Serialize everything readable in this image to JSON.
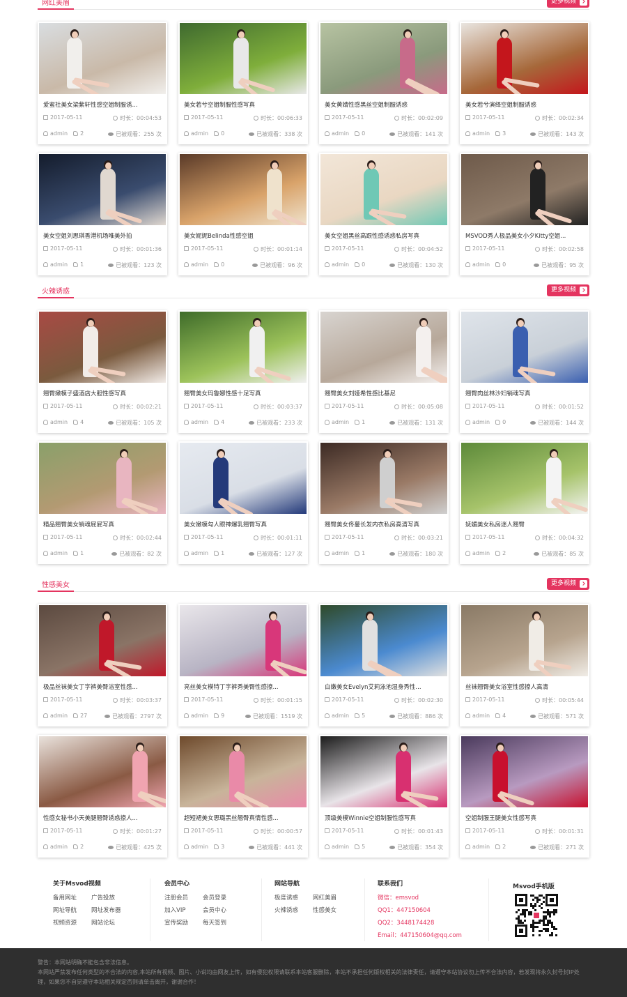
{
  "colors": {
    "accent": "#e4345f",
    "footer_bg": "#2f2f2f"
  },
  "sections": [
    {
      "title": "网红美眉",
      "more": "更多视频",
      "items": [
        {
          "title": "爱蜜社美女梁紫轩性感空姐制服诱...",
          "date": "2017-05-11",
          "duration": "时长：00:04:53",
          "author": "admin",
          "likes": "2",
          "views": "已被观看：255 次",
          "palette": [
            "#d9dde0",
            "#c9b9a8",
            "#f1efec"
          ]
        },
        {
          "title": "美女若兮空姐制服性感写真",
          "date": "2017-05-11",
          "duration": "时长：00:06:33",
          "author": "admin",
          "likes": "0",
          "views": "已被观看：338 次",
          "palette": [
            "#3f6a2f",
            "#7fae3b",
            "#e8e8e8"
          ]
        },
        {
          "title": "美女黄婧性感黑丝空姐制服诱惑",
          "date": "2017-05-11",
          "duration": "时长：00:02:09",
          "author": "admin",
          "likes": "0",
          "views": "已被观看：141 次",
          "palette": [
            "#b7c3a2",
            "#8a9a7c",
            "#c76b8a"
          ]
        },
        {
          "title": "美女若兮演绎空姐制服诱惑",
          "date": "2017-05-11",
          "duration": "时长：00:02:34",
          "author": "admin",
          "likes": "3",
          "views": "已被观看：143 次",
          "palette": [
            "#e9e5e0",
            "#a6683a",
            "#c4161c"
          ]
        },
        {
          "title": "美女空姐刘思琪香港机场唯美外拍",
          "date": "2017-05-11",
          "duration": "时长：00:01:36",
          "author": "admin",
          "likes": "1",
          "views": "已被观看：123 次",
          "palette": [
            "#141c2c",
            "#3a4c6e",
            "#e0d8d0"
          ]
        },
        {
          "title": "美女妮妮Belinda性感空姐",
          "date": "2017-05-11",
          "duration": "时长：00:01:14",
          "author": "admin",
          "likes": "0",
          "views": "已被观看：96 次",
          "palette": [
            "#5a3a28",
            "#d9a36a",
            "#efe2cc"
          ]
        },
        {
          "title": "美女空姐黑丝高跟性感诱惑私房写真",
          "date": "2017-05-11",
          "duration": "时长：00:04:52",
          "author": "admin",
          "likes": "0",
          "views": "已被观看：130 次",
          "palette": [
            "#f2e6d8",
            "#e9d7c2",
            "#6fc8b5"
          ]
        },
        {
          "title": "MSVOD秀人极品美女小夕Kitty空姐...",
          "date": "2017-05-11",
          "duration": "时长：00:02:58",
          "author": "admin",
          "likes": "0",
          "views": "已被观看：95 次",
          "palette": [
            "#6e5a4a",
            "#8e7a68",
            "#222222"
          ]
        }
      ]
    },
    {
      "title": "火辣诱惑",
      "more": "更多视频",
      "items": [
        {
          "title": "翘臀嫩模子盛酒店大胆性感写真",
          "date": "2017-05-11",
          "duration": "时长：00:02:21",
          "author": "admin",
          "likes": "4",
          "views": "已被观看：105 次",
          "palette": [
            "#a84a44",
            "#7a5a3e",
            "#f2ece8"
          ]
        },
        {
          "title": "翘臀美女玛鲁娜性感十足写真",
          "date": "2017-05-11",
          "duration": "时长：00:03:37",
          "author": "admin",
          "likes": "4",
          "views": "已被观看：233 次",
          "palette": [
            "#3f6c2a",
            "#9cc25a",
            "#f0f0f0"
          ]
        },
        {
          "title": "翘臀美女刘娅希性感比基尼",
          "date": "2017-05-11",
          "duration": "时长：00:05:08",
          "author": "admin",
          "likes": "1",
          "views": "已被观看：131 次",
          "palette": [
            "#d8d4d0",
            "#b7a89a",
            "#f4f0ee"
          ]
        },
        {
          "title": "翘臀肉丝林沙妇销魂写真",
          "date": "2017-05-11",
          "duration": "时长：00:01:52",
          "author": "admin",
          "likes": "0",
          "views": "已被观看：144 次",
          "palette": [
            "#dfe4ea",
            "#c9d0d8",
            "#3a5fb0"
          ]
        },
        {
          "title": "精品翘臀美女销魂屁屁写真",
          "date": "2017-05-11",
          "duration": "时长：00:02:44",
          "author": "admin",
          "likes": "1",
          "views": "已被观看：82 次",
          "palette": [
            "#8aa06a",
            "#b39a72",
            "#e8b5c0"
          ]
        },
        {
          "title": "美女嫩模勾人眼神爆乳翘臀写真",
          "date": "2017-05-11",
          "duration": "时长：00:01:11",
          "author": "admin",
          "likes": "1",
          "views": "已被观看：127 次",
          "palette": [
            "#e6eaf0",
            "#d9dee6",
            "#243a7a"
          ]
        },
        {
          "title": "翘臀美女佟蔓长发内衣私房高清写真",
          "date": "2017-05-11",
          "duration": "时长：00:03:21",
          "author": "admin",
          "likes": "1",
          "views": "已被观看：180 次",
          "palette": [
            "#3c2a24",
            "#9a7a66",
            "#cfcfcf"
          ]
        },
        {
          "title": "妩媚美女私房迷人翘臀",
          "date": "2017-05-11",
          "duration": "时长：00:04:32",
          "author": "admin",
          "likes": "2",
          "views": "已被观看：85 次",
          "palette": [
            "#5d8a3a",
            "#a6c36a",
            "#f4f4f4"
          ]
        }
      ]
    },
    {
      "title": "性感美女",
      "more": "更多视频",
      "items": [
        {
          "title": "极品丝袜美女丁字裤美臀浴室性感...",
          "date": "2017-05-11",
          "duration": "时长：00:03:37",
          "author": "admin",
          "likes": "27",
          "views": "已被观看：2797 次",
          "palette": [
            "#5c4a40",
            "#8a7466",
            "#c0182a"
          ]
        },
        {
          "title": "亮丝美女模特丁字裤秀美臀性感撩...",
          "date": "2017-05-11",
          "duration": "时长：00:01:15",
          "author": "admin",
          "likes": "9",
          "views": "已被观看：1519 次",
          "palette": [
            "#e9e6ea",
            "#b8b4c4",
            "#d8377a"
          ]
        },
        {
          "title": "白嫩美女Evelyn艾莉泳池湿身秀性...",
          "date": "2017-05-11",
          "duration": "时长：00:02:30",
          "author": "admin",
          "likes": "5",
          "views": "已被观看：886 次",
          "palette": [
            "#2f4a2a",
            "#4b8ad0",
            "#e0e0e0"
          ]
        },
        {
          "title": "丝袜翘臀美女浴室性感撩人高清",
          "date": "2017-05-11",
          "duration": "时长：00:05:44",
          "author": "admin",
          "likes": "4",
          "views": "已被观看：571 次",
          "palette": [
            "#8a7a66",
            "#b7a48e",
            "#f0ece6"
          ]
        },
        {
          "title": "性感女秘书小天美腿翘臀诱惑撩人...",
          "date": "2017-05-11",
          "duration": "时长：00:01:27",
          "author": "admin",
          "likes": "2",
          "views": "已被观看：425 次",
          "palette": [
            "#e9e2dc",
            "#8a5a44",
            "#f0a4b0"
          ]
        },
        {
          "title": "超短裙美女思璐黑丝翘臀真情性感...",
          "date": "2017-05-11",
          "duration": "时长：00:00:57",
          "author": "admin",
          "likes": "3",
          "views": "已被观看：441 次",
          "palette": [
            "#6e4a2c",
            "#c8b49a",
            "#e98aa8"
          ]
        },
        {
          "title": "顶级美模Winnie空姐制服性感写真",
          "date": "2017-05-11",
          "duration": "时长：00:01:43",
          "author": "admin",
          "likes": "5",
          "views": "已被观看：354 次",
          "palette": [
            "#1c1c1c",
            "#e8e4e8",
            "#d83070"
          ]
        },
        {
          "title": "空姐制服王腿美女性感写真",
          "date": "2017-05-11",
          "duration": "时长：00:01:31",
          "author": "admin",
          "likes": "2",
          "views": "已被观看：271 次",
          "palette": [
            "#4a3a5c",
            "#b89ac0",
            "#c8102e"
          ]
        }
      ]
    }
  ],
  "footer": {
    "about": {
      "title": "关于Msvod视频",
      "links": [
        "备用网址",
        "广告投放",
        "网址导航",
        "网址发布器",
        "视频资源",
        "网站论坛"
      ]
    },
    "member": {
      "title": "会员中心",
      "links": [
        "注册会员",
        "会员登录",
        "加入VIP",
        "会员中心",
        "宣传奖励",
        "每天签到"
      ]
    },
    "nav": {
      "title": "网站导航",
      "links": [
        "极度诱惑",
        "网红美眉",
        "火辣诱惑",
        "性感美女"
      ]
    },
    "contact": {
      "title": "联系我们",
      "lines": [
        "微信：emsvod",
        "QQ1：447150604",
        "QQ2：3448174428",
        "Email：447150604@qq.com"
      ]
    },
    "mobile": {
      "title": "Msvod手机版"
    }
  },
  "disclaimer": {
    "line1": "警告：本网站明确不能包含非法信息。",
    "line2": "本网站严禁发布任何类型的不合法的内容,本站所有视频、图片、小说均由网友上传，如有侵犯权限请联系本站客服删除，本站不承担任何版权相关的法律责任，请遵守本站协议勿上传不合法内容，若发现将永久封号封IP处理，如果您不自觉遵守本站相关规定否则请单击离开，谢谢合作！"
  }
}
